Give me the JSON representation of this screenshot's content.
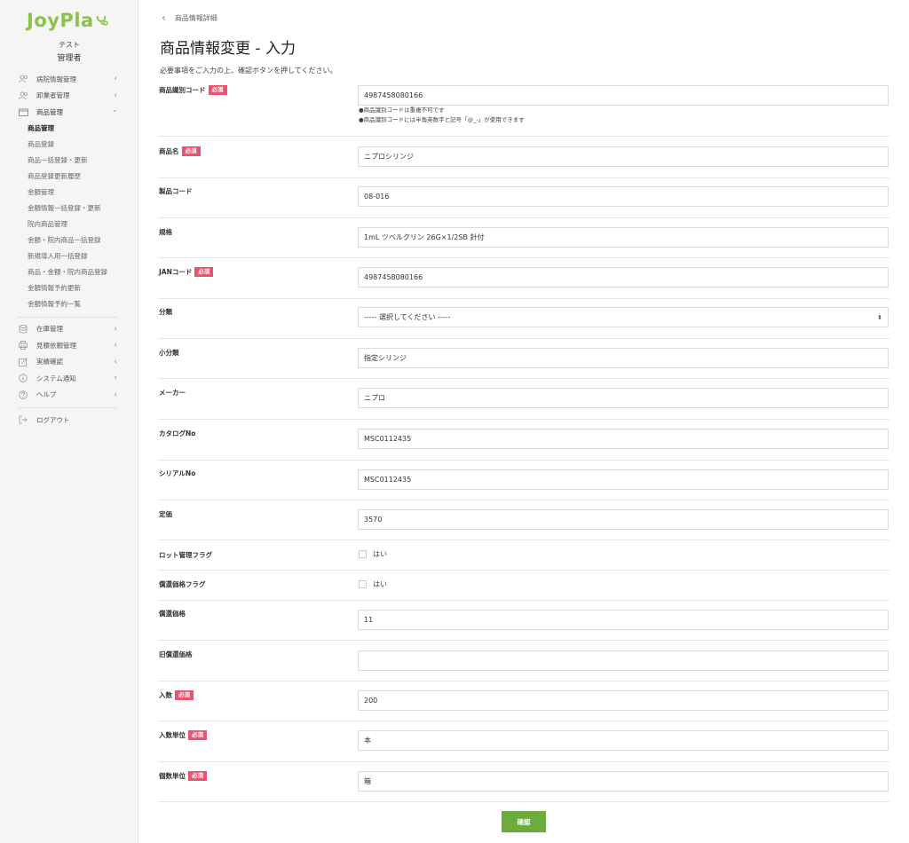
{
  "brand": {
    "logo_text": "JoyPla",
    "accent": "#8bc34a"
  },
  "user": {
    "name": "テスト",
    "role": "管理者"
  },
  "nav": {
    "groups_top": [
      {
        "label": "病院情報管理",
        "icon": "users-icon"
      },
      {
        "label": "卸業者管理",
        "icon": "users-icon"
      }
    ],
    "product_group": {
      "label": "商品管理",
      "icon": "box-icon"
    },
    "product_subitems": [
      "商品管理",
      "商品登録",
      "商品一括登録・更新",
      "商品登録更新履歴",
      "金額管理",
      "金額情報一括登録・更新",
      "院内商品管理",
      "金額・院内商品一括登録",
      "新規導入用一括登録",
      "商品・金額・院内商品登録",
      "金額情報予約更新",
      "金額情報予約一覧"
    ],
    "groups_bottom": [
      {
        "label": "在庫管理",
        "icon": "database-icon"
      },
      {
        "label": "見積依頼管理",
        "icon": "print-icon"
      },
      {
        "label": "実績確認",
        "icon": "edit-icon"
      },
      {
        "label": "システム通知",
        "icon": "info-icon"
      },
      {
        "label": "ヘルプ",
        "icon": "question-icon"
      }
    ],
    "logout": "ログアウト"
  },
  "breadcrumb": "商品情報詳細",
  "title": "商品情報変更 - 入力",
  "description": "必要事項をご入力の上、確認ボタンを押してください。",
  "required_badge": "必須",
  "form": {
    "product_id": {
      "label": "商品識別コード",
      "value": "4987458080166",
      "help1": "●商品識別コードは重複不可です",
      "help2": "●商品識別コードには半角英数字と記号「@_-」が使用できます"
    },
    "product_name": {
      "label": "商品名",
      "value": "ニプロシリンジ"
    },
    "product_code": {
      "label": "製品コード",
      "value": "08-016"
    },
    "spec": {
      "label": "規格",
      "value": "1mL ツベルクリン 26G×1/2SB 針付"
    },
    "jan": {
      "label": "JANコード",
      "value": "4987458080166"
    },
    "category": {
      "label": "分類",
      "value": "----- 選択してください -----"
    },
    "subcategory": {
      "label": "小分類",
      "value": "指定シリンジ"
    },
    "maker": {
      "label": "メーカー",
      "value": "ニプロ"
    },
    "catalog": {
      "label": "カタログNo",
      "value": "MSC0112435"
    },
    "serial": {
      "label": "シリアルNo",
      "value": "MSC0112435"
    },
    "list_price": {
      "label": "定価",
      "value": "3570"
    },
    "lot_flag": {
      "label": "ロット管理フラグ",
      "option": "はい"
    },
    "reimb_flag": {
      "label": "償還価格フラグ",
      "option": "はい"
    },
    "reimb_price": {
      "label": "償還価格",
      "value": "11"
    },
    "old_reimb_price": {
      "label": "旧償還価格",
      "value": ""
    },
    "quantity": {
      "label": "入数",
      "value": "200"
    },
    "quantity_unit": {
      "label": "入数単位",
      "value": "本"
    },
    "item_unit": {
      "label": "個数単位",
      "value": "箱"
    }
  },
  "confirm_button": "確認"
}
